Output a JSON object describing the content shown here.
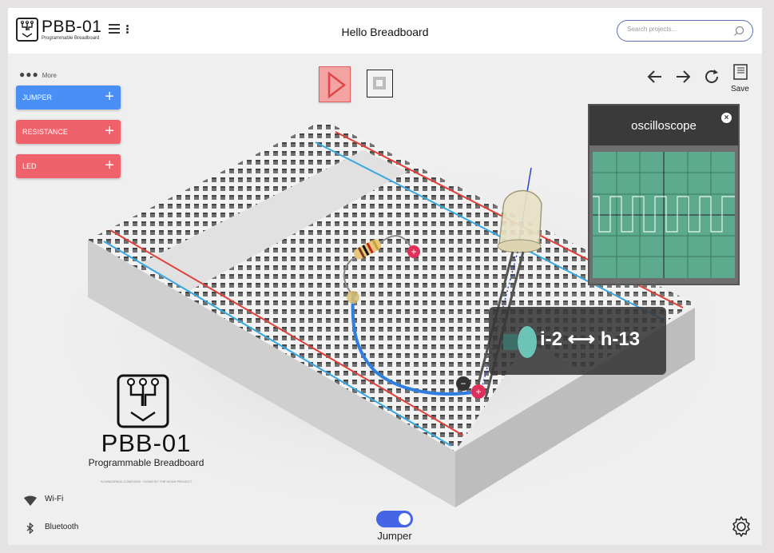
{
  "app": {
    "brand": "PBB-01",
    "brand_sub": "Programmable Breadboard",
    "title": "Hello Breadboard"
  },
  "search": {
    "placeholder": "Search projects..."
  },
  "sidebar": {
    "more_label": "More",
    "buttons": [
      {
        "label": "JUMPER",
        "color": "#4a8ff5"
      },
      {
        "label": "RESISTANCE",
        "color": "#f0626b"
      },
      {
        "label": "LED",
        "color": "#f0626b"
      }
    ]
  },
  "controls": {
    "play": "play",
    "stop": "stop"
  },
  "toolbar": {
    "save_label": "Save"
  },
  "oscilloscope": {
    "title": "oscilloscope"
  },
  "tooltip": {
    "text": "i-2 ⟷ h-13"
  },
  "big_logo": {
    "title": "PBB-01",
    "subtitle": "Programmable Breadboard",
    "tiny": "SOUNDSPACE.COM©2020 · ICONS BY THE NOUN PROJECT"
  },
  "status": {
    "wifi_label": "Wi-Fi",
    "bluetooth_label": "Bluetooth"
  },
  "mode_toggle": {
    "label": "Jumper",
    "on": true
  },
  "colors": {
    "accent_blue": "#4466e6",
    "jumper_button": "#4a8ff5",
    "red_button": "#f0626b",
    "osc_screen": "#5cab8f",
    "wire": "#2f7fe0",
    "rail_red": "#e0403a",
    "rail_blue": "#39a8e0"
  }
}
